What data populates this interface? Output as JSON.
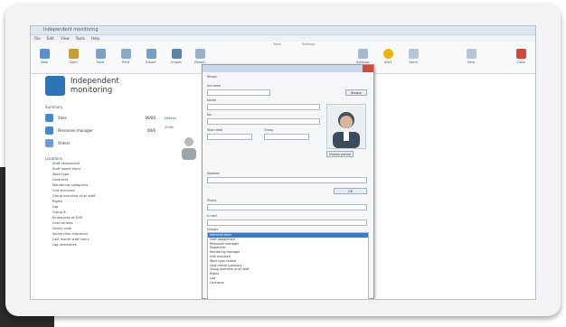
{
  "window": {
    "title": "Independent monitoring"
  },
  "menu": [
    "File",
    "Edit",
    "View",
    "Tools",
    "Help"
  ],
  "ribbon": {
    "buttons": [
      "New",
      "Open",
      "Save",
      "Print",
      "Export",
      "Import",
      "Report",
      "Settings",
      "Alert",
      "Users",
      "Help",
      "Close"
    ],
    "groups": [
      "Tools",
      "Settings"
    ]
  },
  "app": {
    "title": "Independent monitoring"
  },
  "left": {
    "section_title": "Summary",
    "items": [
      {
        "label": "Sites",
        "value": "00/00"
      },
      {
        "label": "Personnel manager",
        "value": "00/0"
      },
      {
        "label": "Orders",
        "value": ""
      }
    ],
    "links_title": "Locations",
    "links": [
      "Staff assignment",
      "Staff report entry",
      "Work type",
      "Contracts",
      "Monitoring categories",
      "Unit structure",
      "Group overview of all staff",
      "Rights",
      "Log",
      "Group B",
      "Employees at EUR",
      "Cost centres",
      "Salary code",
      "Active time allocation",
      "Last month staff hours",
      "Log directories"
    ]
  },
  "column": {
    "label": "Details",
    "sub": "Shifts"
  },
  "dialog": {
    "tab": "Person",
    "label_name": "Surname",
    "label_first": "Name",
    "label_id": "No.",
    "label_since": "Start date",
    "label_group": "Group",
    "label_address": "Address",
    "label_phone": "Phone",
    "label_email": "E-mail",
    "browse_button": "Browse",
    "upload_button": "Choose picture",
    "ok_button": "OK",
    "list_label": "Groups",
    "list": [
      "Administration",
      "Staff assignment",
      "Personnel manager",
      "Dispatcher",
      "Monitoring manager",
      "Unit structure",
      "Work type central",
      "Cost centre summary",
      "Group overview of all staff",
      "Rights",
      "Log",
      "Contracts"
    ]
  }
}
